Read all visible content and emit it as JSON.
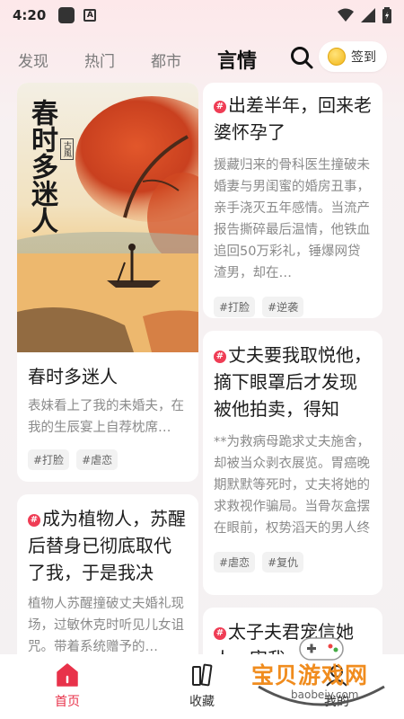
{
  "status_bar": {
    "time": "4:20",
    "app_badge": "A"
  },
  "nav": {
    "tabs": [
      {
        "label": "发现"
      },
      {
        "label": "热门"
      },
      {
        "label": "都市"
      },
      {
        "label": "言情",
        "active": true
      }
    ],
    "checkin_label": "签到"
  },
  "cards": [
    {
      "id": "chunshi",
      "cover_title": "春时多迷人",
      "cover_stamp": "古風",
      "title": "春时多迷人",
      "desc": "表妹看上了我的未婚夫，在我的生辰宴上自荐枕席…",
      "tags": [
        "#打脸",
        "#虐恋"
      ],
      "has_hash": false
    },
    {
      "id": "chuchai",
      "title": "出差半年，回来老婆怀孕了",
      "desc": "援藏归来的骨科医生撞破未婚妻与男闺蜜的婚房丑事，亲手浇灭五年感情。当流产报告撕碎最后温情，他铁血追回50万彩礼，锤爆网贷渣男，却在…",
      "tags": [
        "#打脸",
        "#逆袭"
      ],
      "has_hash": true
    },
    {
      "id": "zhiwuren",
      "title": "成为植物人，苏醒后替身已彻底取代了我，于是我决定…",
      "desc": "植物人苏醒撞破丈夫婚礼现场，过敏休克时听见儿女诅咒。带着系统赠予的…",
      "tags": [],
      "has_hash": true
    },
    {
      "id": "zhangfu",
      "title": "丈夫要我取悦他，摘下眼罩后才发现被他拍卖，得知我…",
      "desc": "**为救病母跪求丈夫施舍，却被当众剥衣展览。胃癌晚期默默等死时，丈夫将她的求救视作骗局。当骨灰盒摆在眼前，权势滔天的男人终于疯了——…",
      "tags": [
        "#虐恋",
        "#复仇"
      ],
      "has_hash": true
    },
    {
      "id": "taizifu",
      "title": "太子夫君宠信她人，害我",
      "desc": "",
      "tags": [],
      "has_hash": true
    }
  ],
  "bottom_nav": [
    {
      "label": "首页",
      "active": true
    },
    {
      "label": "收藏"
    },
    {
      "label": "我的"
    }
  ],
  "watermark": {
    "text": "宝贝游戏网",
    "url": "baobeiy.com"
  },
  "colors": {
    "accent": "#e8324a",
    "hash_badge": "#ef3d55"
  }
}
